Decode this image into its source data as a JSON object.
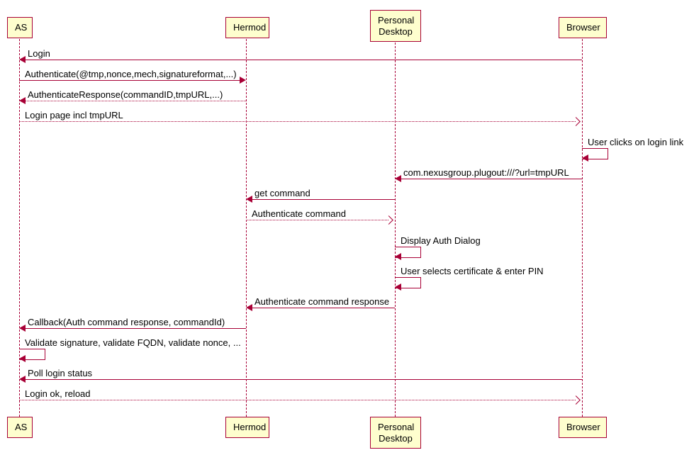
{
  "participants": {
    "as": "AS",
    "hermod": "Hermod",
    "personal_desktop_line1": "Personal",
    "personal_desktop_line2": "Desktop",
    "browser": "Browser"
  },
  "messages": {
    "m1": "Login",
    "m2": "Authenticate(@tmp,nonce,mech,signatureformat,...)",
    "m3": "AuthenticateResponse(commandID,tmpURL,...)",
    "m4": "Login page incl tmpURL",
    "m5": "User clicks on login link",
    "m6": "com.nexusgroup.plugout:///?url=tmpURL",
    "m7": "get command",
    "m8": "Authenticate command",
    "m9": "Display Auth Dialog",
    "m10": "User selects certificate & enter PIN",
    "m11": "Authenticate command response",
    "m12": "Callback(Auth command response, commandId)",
    "m13": "Validate signature, validate FQDN, validate nonce, ...",
    "m14": "Poll login status",
    "m15": "Login ok, reload"
  },
  "layout": {
    "x": {
      "as": 27,
      "hermod": 347,
      "pd": 557,
      "browser": 821
    },
    "yTop": 55,
    "yBottom": 585,
    "boxTopY": 20,
    "boxBottomY": 590
  },
  "chart_data": {
    "type": "sequence-diagram",
    "participants": [
      "AS",
      "Hermod",
      "Personal Desktop",
      "Browser"
    ],
    "messages": [
      {
        "from": "Browser",
        "to": "AS",
        "label": "Login",
        "style": "solid"
      },
      {
        "from": "AS",
        "to": "Hermod",
        "label": "Authenticate(@tmp,nonce,mech,signatureformat,...)",
        "style": "solid"
      },
      {
        "from": "Hermod",
        "to": "AS",
        "label": "AuthenticateResponse(commandID,tmpURL,...)",
        "style": "dashed"
      },
      {
        "from": "AS",
        "to": "Browser",
        "label": "Login page incl tmpURL",
        "style": "dashed"
      },
      {
        "from": "Browser",
        "to": "Browser",
        "label": "User clicks on login link",
        "style": "solid"
      },
      {
        "from": "Browser",
        "to": "Personal Desktop",
        "label": "com.nexusgroup.plugout:///?url=tmpURL",
        "style": "solid"
      },
      {
        "from": "Personal Desktop",
        "to": "Hermod",
        "label": "get command",
        "style": "solid"
      },
      {
        "from": "Hermod",
        "to": "Personal Desktop",
        "label": "Authenticate command",
        "style": "dashed"
      },
      {
        "from": "Personal Desktop",
        "to": "Personal Desktop",
        "label": "Display Auth Dialog",
        "style": "solid"
      },
      {
        "from": "Personal Desktop",
        "to": "Personal Desktop",
        "label": "User selects certificate & enter PIN",
        "style": "solid"
      },
      {
        "from": "Personal Desktop",
        "to": "Hermod",
        "label": "Authenticate command response",
        "style": "solid"
      },
      {
        "from": "Hermod",
        "to": "AS",
        "label": "Callback(Auth command response, commandId)",
        "style": "solid"
      },
      {
        "from": "AS",
        "to": "AS",
        "label": "Validate signature, validate FQDN, validate nonce, ...",
        "style": "solid"
      },
      {
        "from": "Browser",
        "to": "AS",
        "label": "Poll login status",
        "style": "solid"
      },
      {
        "from": "AS",
        "to": "Browser",
        "label": "Login ok, reload",
        "style": "dashed"
      }
    ]
  }
}
